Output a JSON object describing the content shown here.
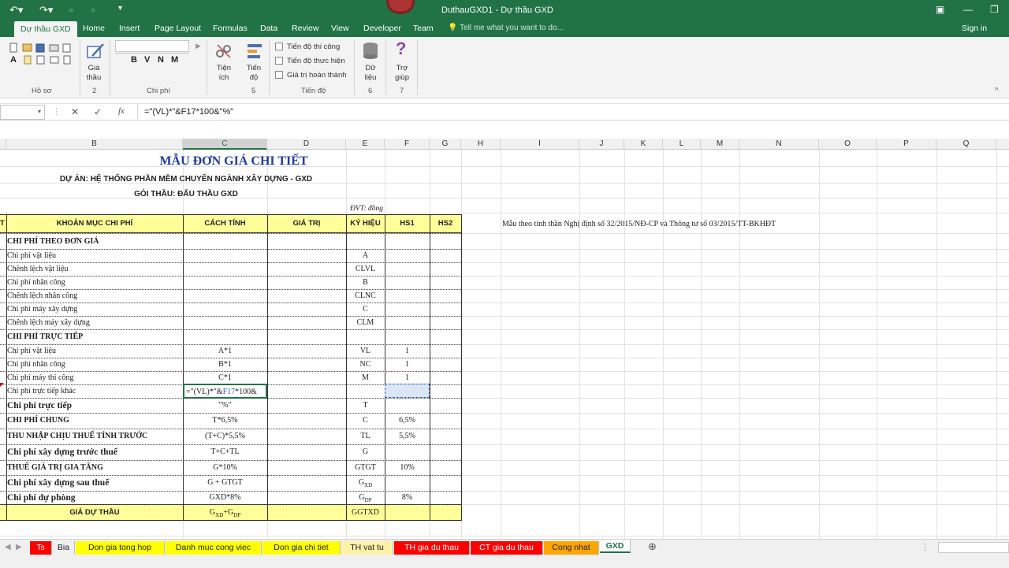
{
  "window": {
    "title": "DuthauGXD1 - Dự thầu GXD"
  },
  "ribbon_tabs": [
    {
      "label": "Dự thầu GXD"
    },
    {
      "label": "Home"
    },
    {
      "label": "Insert"
    },
    {
      "label": "Page Layout"
    },
    {
      "label": "Formulas"
    },
    {
      "label": "Data"
    },
    {
      "label": "Review"
    },
    {
      "label": "View"
    },
    {
      "label": "Developer"
    },
    {
      "label": "Team"
    }
  ],
  "tell_me_placeholder": "Tell me what you want to do...",
  "sign_in": "Sign in",
  "ribbon": {
    "groups": {
      "ho_so": "Hồ sơ",
      "two": "2",
      "chi_phi": "Chi phí",
      "five": "5",
      "tien_do": "Tiến độ",
      "six": "6",
      "seven": "7"
    },
    "gia_thau": [
      "Giá",
      "thầu"
    ],
    "tien_ich": [
      "Tiện",
      "ích"
    ],
    "tien_do_btn": [
      "Tiến",
      "độ"
    ],
    "du_lieu": [
      "Dữ",
      "liệu"
    ],
    "tro_giup": [
      "Trợ",
      "giúp"
    ],
    "checkboxes": [
      "Tiến độ thi công",
      "Tiến độ thực hiện",
      "Giá trị hoàn thành"
    ],
    "format_letters": [
      "A",
      "B",
      "V",
      "N",
      "M"
    ]
  },
  "formula_bar": {
    "formula": "=\"(VL)*\"&F17*100&\"%\""
  },
  "columns": [
    "B",
    "C",
    "D",
    "E",
    "F",
    "G",
    "H",
    "I",
    "J",
    "K",
    "L",
    "M",
    "N",
    "O",
    "P",
    "Q"
  ],
  "sheet": {
    "title": "MẪU ĐƠN GIÁ CHI TIẾT",
    "project": "DỰ ÁN: HỆ THỐNG PHẦN MỀM CHUYÊN NGÀNH XÂY DỰNG - GXD",
    "package": "GÓI THẦU: ĐẤU THẦU GXD",
    "unit": "ĐVT: đồng",
    "note": "Mẫu theo tinh thần Nghị định số 32/2015/NĐ-CP và Thông tư số 03/2015/TT-BKHĐT",
    "header_left": "T",
    "headers": [
      "KHOẢN MỤC CHI PHÍ",
      "CÁCH TÍNH",
      "GIÁ TRỊ",
      "KÝ HIỆU",
      "HS1",
      "HS2"
    ],
    "rows": [
      {
        "b": "CHI PHÍ THEO ĐƠN GIÁ",
        "c": "",
        "e": "",
        "f": "",
        "style": "bold"
      },
      {
        "b": "Chi phí vật liệu",
        "c": "",
        "e": "A",
        "f": ""
      },
      {
        "b": "Chênh lệch vật liệu",
        "c": "",
        "e": "CLVL",
        "f": ""
      },
      {
        "b": "Chi phí nhân công",
        "c": "",
        "e": "B",
        "f": ""
      },
      {
        "b": "Chênh lệch nhân công",
        "c": "",
        "e": "CLNC",
        "f": ""
      },
      {
        "b": "Chi phí máy xây dựng",
        "c": "",
        "e": "C",
        "f": ""
      },
      {
        "b": "Chênh lệch máy xây dựng",
        "c": "",
        "e": "CLM",
        "f": ""
      },
      {
        "b": "CHI PHÍ TRỰC TIẾP",
        "c": "",
        "e": "",
        "f": "",
        "style": "bold"
      },
      {
        "b": "Chi phí vật liệu",
        "c": "A*1",
        "e": "VL",
        "f": "1"
      },
      {
        "b": "Chi phí nhân công",
        "c": "B*1",
        "e": "NC",
        "f": "1"
      },
      {
        "b": "Chi phí máy thi công",
        "c": "C*1",
        "e": "M",
        "f": "1"
      },
      {
        "b": "Chi phí trực tiếp khác",
        "c": "",
        "e": "",
        "f": ""
      },
      {
        "b": "Chi phí trực tiếp",
        "c": "\"%\"",
        "e": "T",
        "f": "",
        "style": "bold-lg"
      },
      {
        "b": "CHI PHÍ CHUNG",
        "c": "T*6,5%",
        "e": "C",
        "f": "6,5%",
        "style": "bold"
      },
      {
        "b": "THU NHẬP CHỊU THUẾ TÍNH TRƯỚC",
        "c": "(T+C)*5,5%",
        "e": "TL",
        "f": "5,5%",
        "style": "bold"
      },
      {
        "b": "Chi phí xây dựng trước thuế",
        "c": "T+C+TL",
        "e": "G",
        "f": "",
        "style": "bold-lg"
      },
      {
        "b": "THUẾ GIÁ TRỊ GIA TĂNG",
        "c": "G*10%",
        "e": "GTGT",
        "f": "10%",
        "style": "bold"
      },
      {
        "b": "Chi phí xây dựng sau thuế",
        "c": "G + GTGT",
        "e": "G",
        "e_sub": "XD",
        "f": "",
        "style": "bold-lg"
      },
      {
        "b": "Chi phí dự phòng",
        "c": "GXD*8%",
        "e": "G",
        "e_sub": "DP",
        "f": "8%",
        "style": "bold-lg"
      }
    ],
    "total": {
      "b": "GIÁ DỰ THẦU",
      "c1": "G",
      "c1_sub": "XD",
      "c2": "+G",
      "c2_sub": "DP",
      "e": "GGTXD"
    },
    "edit_cell": {
      "line1_a": "=\"(VL)*\"&",
      "line1_ref": "F17",
      "line1_b": "*100&"
    }
  },
  "sheet_tabs": [
    {
      "label": "Ts",
      "color": "#ff0000",
      "text_color": "#ffffff"
    },
    {
      "label": "Bia",
      "color": "#f0f0f0",
      "text_color": "#222222"
    },
    {
      "label": "Don gia tong hop",
      "color": "#ffff00",
      "text_color": "#222222"
    },
    {
      "label": "Danh muc cong viec",
      "color": "#ffff00",
      "text_color": "#222222"
    },
    {
      "label": "Don gia chi tiet",
      "color": "#ffff00",
      "text_color": "#222222"
    },
    {
      "label": "TH vat tu",
      "color": "#fff2a8",
      "text_color": "#222222"
    },
    {
      "label": "TH gia du thau",
      "color": "#ff0000",
      "text_color": "#ffffff"
    },
    {
      "label": "CT gia du thau",
      "color": "#ff0000",
      "text_color": "#ffffff"
    },
    {
      "label": "Cong nhat",
      "color": "#ffa500",
      "text_color": "#222222"
    },
    {
      "label": "GXD",
      "color": "#ffffff",
      "text_color": "#217346"
    }
  ]
}
